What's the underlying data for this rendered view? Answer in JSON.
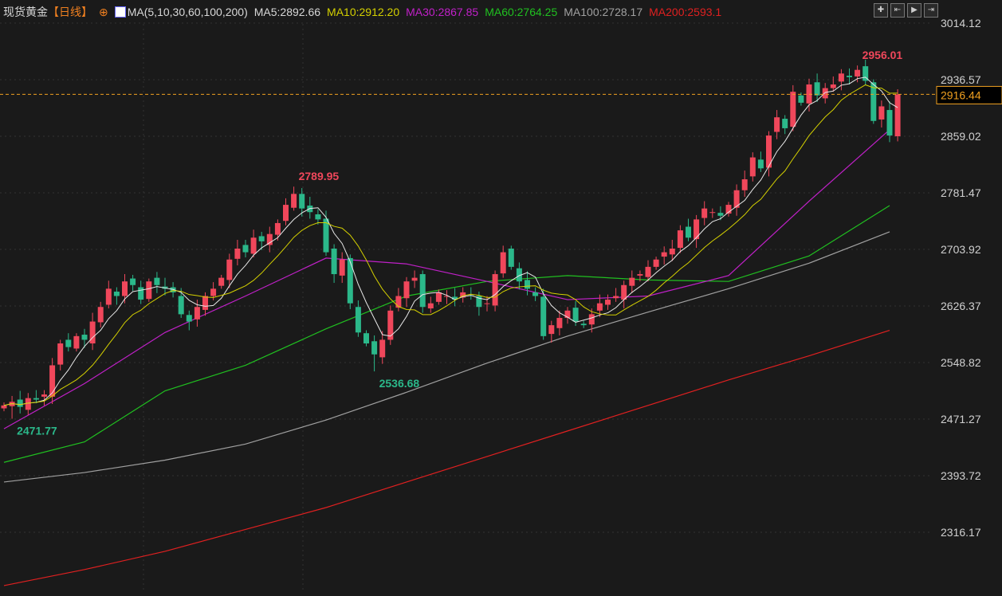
{
  "header": {
    "symbol": "现货黄金",
    "period": "【日线】",
    "indicator": "MA(5,10,30,60,100,200)",
    "ma5": "MA5:2892.66",
    "ma10": "MA10:2912.20",
    "ma30": "MA30:2867.85",
    "ma60": "MA60:2764.25",
    "ma100": "MA100:2728.17",
    "ma200": "MA200:2593.1"
  },
  "toolbar": [
    "crosshair",
    "zoom-range",
    "play",
    "exit"
  ],
  "colors": {
    "up": "#f0475b",
    "down": "#2bb88a",
    "ma5": "#e8e8e8",
    "ma10": "#d4d000",
    "ma30": "#c020c8",
    "ma60": "#20c020",
    "ma100": "#a0a0a0",
    "ma200": "#e02020",
    "last": "#f0a020"
  },
  "chart_data": {
    "type": "candlestick",
    "title": "现货黄金 日线",
    "y_ticks": [
      "3014.12",
      "2936.57",
      "2859.02",
      "2781.47",
      "2703.92",
      "2626.37",
      "2548.82",
      "2471.27",
      "2393.72",
      "2316.17"
    ],
    "ylim": [
      2316.17,
      3014.12
    ],
    "last_price": "2916.44",
    "closes": [
      2490,
      2495,
      2488,
      2500,
      2498,
      2505,
      2545,
      2575,
      2570,
      2585,
      2580,
      2605,
      2625,
      2650,
      2640,
      2660,
      2655,
      2635,
      2660,
      2655,
      2650,
      2645,
      2615,
      2605,
      2625,
      2640,
      2650,
      2665,
      2690,
      2705,
      2700,
      2720,
      2715,
      2725,
      2740,
      2765,
      2780,
      2760,
      2755,
      2745,
      2700,
      2670,
      2690,
      2630,
      2590,
      2575,
      2560,
      2580,
      2620,
      2640,
      2660,
      2665,
      2625,
      2630,
      2645,
      2640,
      2635,
      2645,
      2640,
      2625,
      2630,
      2670,
      2700,
      2680,
      2660,
      2650,
      2640,
      2585,
      2600,
      2610,
      2620,
      2605,
      2600,
      2615,
      2630,
      2635,
      2640,
      2655,
      2665,
      2670,
      2680,
      2690,
      2700,
      2705,
      2730,
      2720,
      2745,
      2760,
      2755,
      2750,
      2765,
      2785,
      2800,
      2830,
      2815,
      2860,
      2885,
      2870,
      2920,
      2905,
      2930,
      2915,
      2925,
      2930,
      2945,
      2940,
      2950,
      2935,
      2880,
      2900,
      2860,
      2916.44
    ],
    "annotations": [
      {
        "index": 106,
        "type": "high",
        "value": "2956.01"
      },
      {
        "index": 36,
        "type": "high",
        "value": "2789.95"
      },
      {
        "index": 46,
        "type": "low",
        "value": "2536.68"
      },
      {
        "index": 1,
        "type": "low",
        "value": "2471.77"
      }
    ],
    "ma_samples_every": 10,
    "ma30": [
      2458,
      2520,
      2590,
      2640,
      2692,
      2684,
      2660,
      2635,
      2640,
      2668,
      2770,
      2868
    ],
    "ma60": [
      2412,
      2440,
      2510,
      2545,
      2595,
      2640,
      2660,
      2668,
      2662,
      2660,
      2695,
      2764
    ],
    "ma100": [
      2385,
      2398,
      2415,
      2437,
      2470,
      2508,
      2548,
      2585,
      2618,
      2650,
      2685,
      2728
    ],
    "ma200": [
      2243,
      2265,
      2290,
      2320,
      2350,
      2385,
      2420,
      2455,
      2490,
      2525,
      2558,
      2593
    ]
  }
}
